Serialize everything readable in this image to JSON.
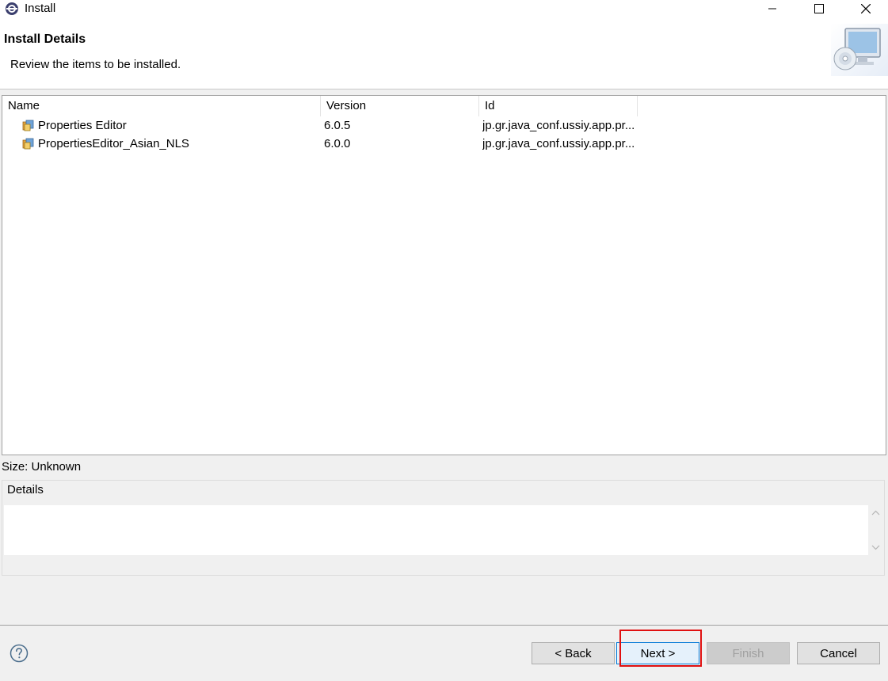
{
  "window": {
    "title": "Install",
    "app_icon": "eclipse-gear-icon",
    "controls": [
      "minimize-icon",
      "maximize-icon",
      "close-icon"
    ]
  },
  "banner": {
    "title": "Install Details",
    "description": "Review the items to be installed.",
    "image": "install-wizard-cd-monitor-image"
  },
  "table": {
    "columns": [
      "Name",
      "Version",
      "Id"
    ],
    "rows": [
      {
        "icon": "feature-icon",
        "name": "Properties Editor",
        "version": "6.0.5",
        "id": "jp.gr.java_conf.ussiy.app.pr..."
      },
      {
        "icon": "feature-icon",
        "name": "PropertiesEditor_Asian_NLS",
        "version": "6.0.0",
        "id": "jp.gr.java_conf.ussiy.app.pr..."
      }
    ]
  },
  "size_label": "Size: Unknown",
  "details": {
    "legend": "Details",
    "text": ""
  },
  "buttons": {
    "help_icon": "help-question-icon",
    "back": "< Back",
    "next": "Next >",
    "finish": "Finish",
    "cancel": "Cancel",
    "finish_enabled": false
  },
  "colors": {
    "highlight_border": "#e01010",
    "focus_border": "#0078d7"
  }
}
